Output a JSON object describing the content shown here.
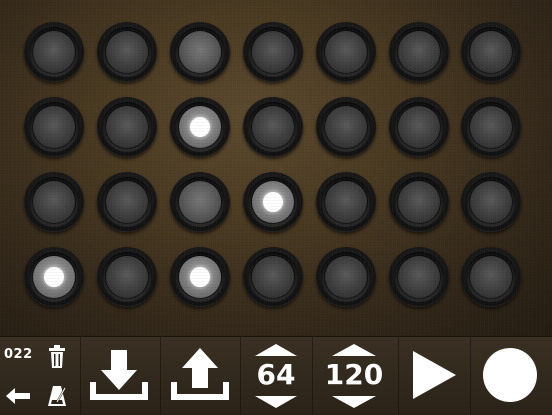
{
  "sequencer": {
    "rows": 4,
    "cols": 7,
    "active_steps": [
      {
        "row": 2,
        "col": 3
      },
      {
        "row": 3,
        "col": 4
      },
      {
        "row": 4,
        "col": 1
      },
      {
        "row": 4,
        "col": 3
      }
    ],
    "highlighted_columns": [
      3
    ]
  },
  "toolbar": {
    "counter": "022",
    "steps_value": "64",
    "tempo_value": "120"
  },
  "icons": {
    "clear": "trash-icon",
    "back": "arrow-left-icon",
    "metronome": "metronome-icon",
    "download": "download-icon",
    "upload": "upload-icon",
    "play": "play-icon",
    "record": "record-icon"
  }
}
